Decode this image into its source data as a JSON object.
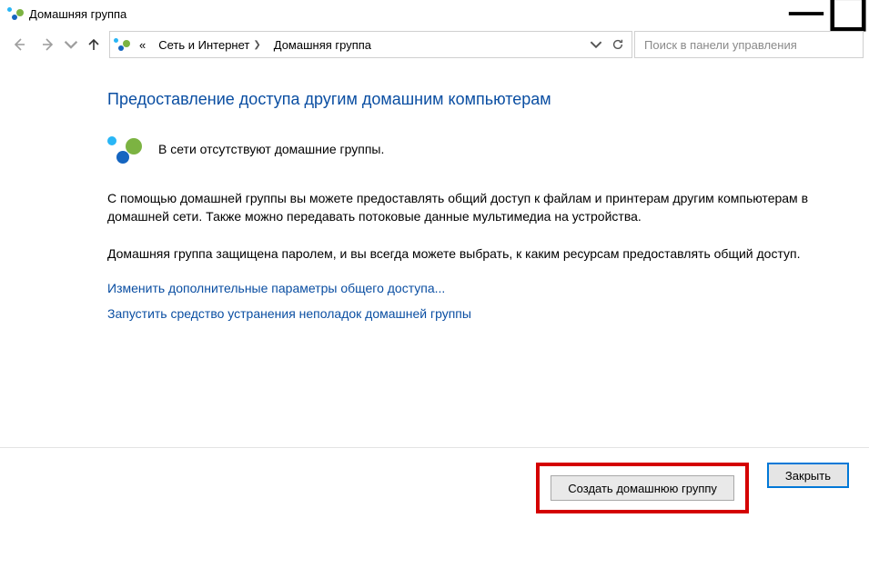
{
  "window": {
    "title": "Домашняя группа"
  },
  "nav": {
    "crumb_prefix": "«",
    "crumb1": "Сеть и Интернет",
    "crumb2": "Домашняя группа"
  },
  "search": {
    "placeholder": "Поиск в панели управления"
  },
  "page": {
    "heading": "Предоставление доступа другим домашним компьютерам",
    "status": "В сети отсутствуют домашние группы.",
    "para1": "С помощью домашней группы вы можете предоставлять общий доступ к файлам и принтерам другим компьютерам в домашней сети. Также можно передавать потоковые данные мультимедиа на устройства.",
    "para2": "Домашняя группа защищена паролем, и вы всегда можете выбрать, к каким ресурсам предоставлять общий доступ.",
    "link1": "Изменить дополнительные параметры общего доступа...",
    "link2": "Запустить средство устранения неполадок домашней группы"
  },
  "buttons": {
    "create": "Создать домашнюю группу",
    "close": "Закрыть"
  }
}
